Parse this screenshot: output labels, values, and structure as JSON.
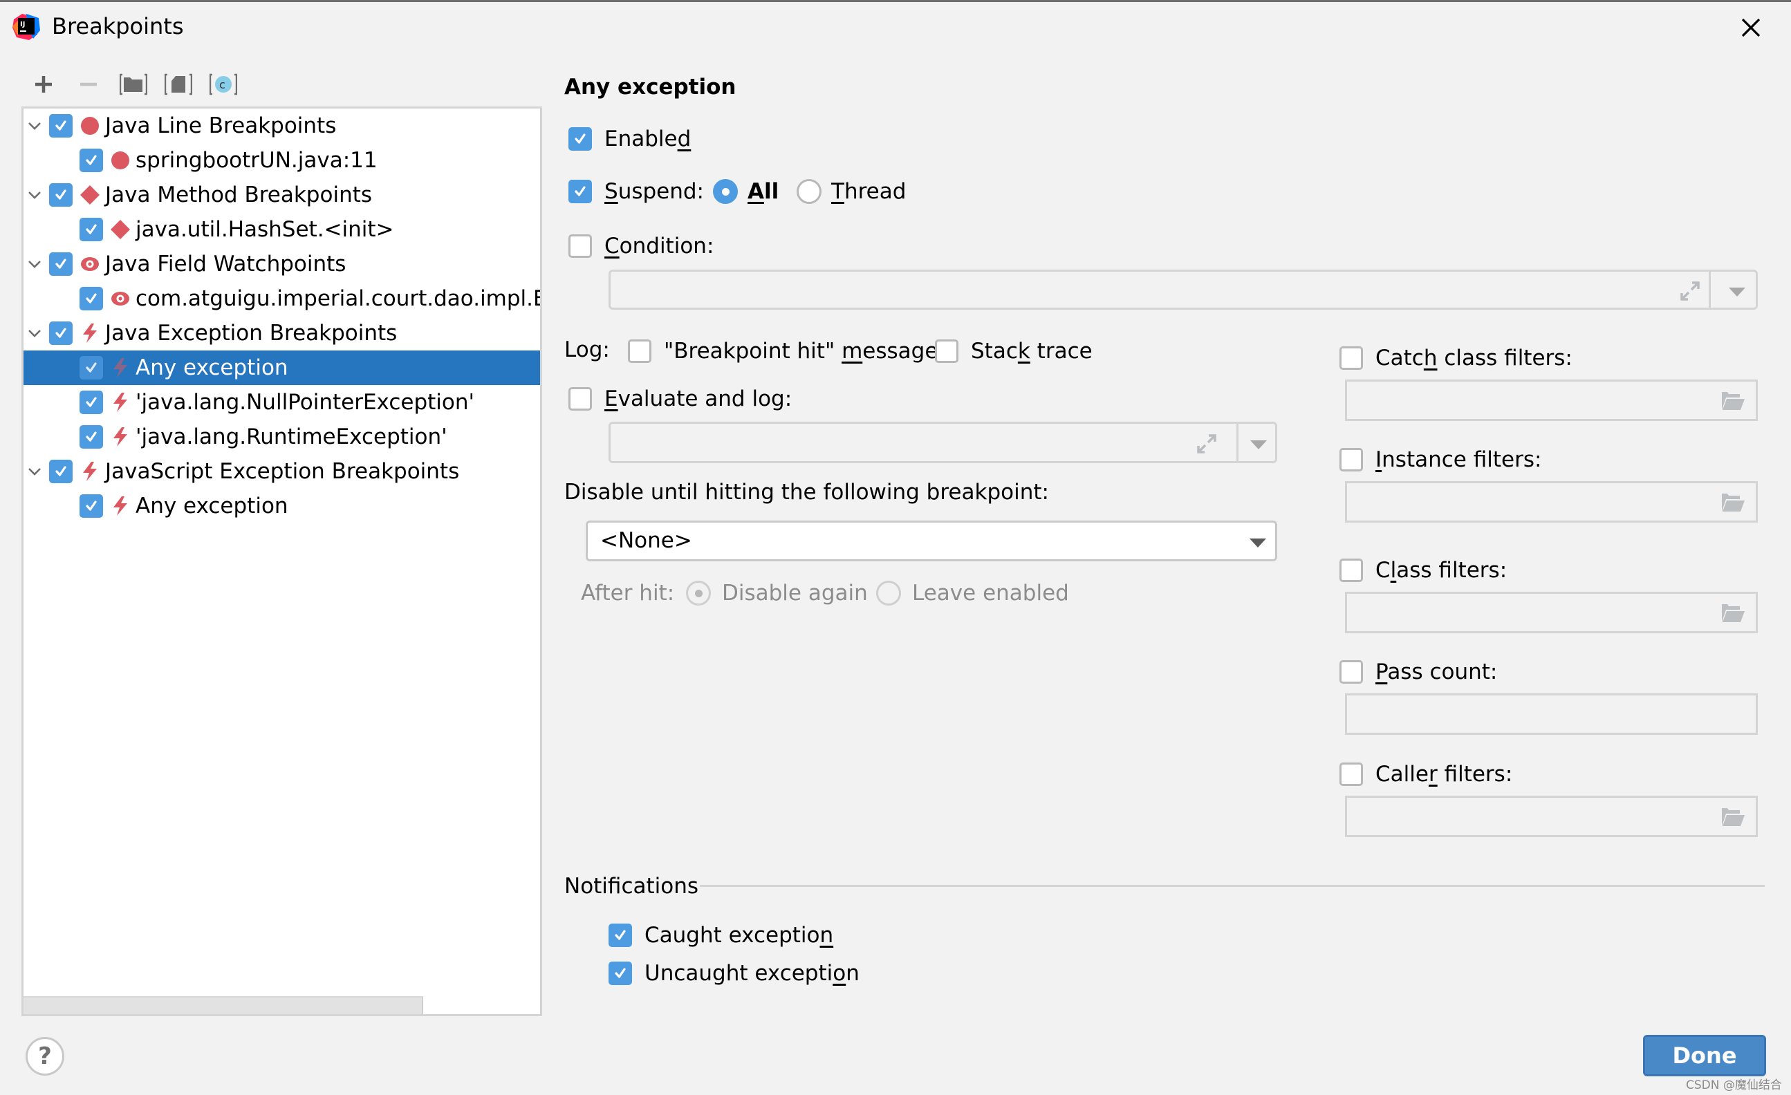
{
  "window": {
    "title": "Breakpoints",
    "app_icon": "intellij-idea-icon",
    "close_icon": "close-icon"
  },
  "toolbar": {
    "buttons": [
      {
        "name": "add-breakpoint-button",
        "icon": "plus-icon",
        "enabled": true
      },
      {
        "name": "remove-breakpoint-button",
        "icon": "minus-icon",
        "enabled": false
      },
      {
        "name": "group-by-package-button",
        "icon": "folder-group-icon",
        "enabled": true
      },
      {
        "name": "group-by-file-button",
        "icon": "file-group-icon",
        "enabled": true
      },
      {
        "name": "group-by-class-button",
        "icon": "class-group-icon",
        "enabled": true
      }
    ]
  },
  "tree": {
    "items": [
      {
        "label": "Java Line Breakpoints",
        "level": 0,
        "expanded": true,
        "checked": true,
        "icon": "line-breakpoint-icon"
      },
      {
        "label": "springbootrUN.java:11",
        "level": 1,
        "checked": true,
        "icon": "line-breakpoint-icon"
      },
      {
        "label": "Java Method Breakpoints",
        "level": 0,
        "expanded": true,
        "checked": true,
        "icon": "method-breakpoint-icon"
      },
      {
        "label": "java.util.HashSet.<init>",
        "level": 1,
        "checked": true,
        "icon": "method-breakpoint-icon"
      },
      {
        "label": "Java Field Watchpoints",
        "level": 0,
        "expanded": true,
        "checked": true,
        "icon": "field-watchpoint-icon"
      },
      {
        "label": "com.atguigu.imperial.court.dao.impl.Em",
        "level": 1,
        "checked": true,
        "icon": "field-watchpoint-icon"
      },
      {
        "label": "Java Exception Breakpoints",
        "level": 0,
        "expanded": true,
        "checked": true,
        "icon": "exception-breakpoint-icon"
      },
      {
        "label": "Any exception",
        "level": 1,
        "checked": true,
        "icon": "exception-breakpoint-icon",
        "selected": true
      },
      {
        "label": "'java.lang.NullPointerException'",
        "level": 1,
        "checked": true,
        "icon": "exception-breakpoint-icon"
      },
      {
        "label": "'java.lang.RuntimeException'",
        "level": 1,
        "checked": true,
        "icon": "exception-breakpoint-icon"
      },
      {
        "label": "JavaScript Exception Breakpoints",
        "level": 0,
        "expanded": true,
        "checked": true,
        "icon": "exception-breakpoint-icon"
      },
      {
        "label": "Any exception",
        "level": 1,
        "checked": true,
        "icon": "exception-breakpoint-icon"
      }
    ]
  },
  "details": {
    "heading": "Any exception",
    "enabled": {
      "label_pre": "Enable",
      "label_u": "d",
      "label_post": "",
      "checked": true
    },
    "suspend": {
      "label_u": "S",
      "label_post": "uspend:",
      "checked": true,
      "options": [
        {
          "u": "A",
          "rest": "ll",
          "selected": true
        },
        {
          "u": "T",
          "rest": "hread",
          "selected": false
        }
      ]
    },
    "condition": {
      "label_u": "C",
      "label_post": "ondition:",
      "checked": false,
      "value": ""
    },
    "log": {
      "label": "Log:",
      "breakpoint_hit": {
        "pre": "\"Breakpoint hit\" ",
        "u": "m",
        "post": "essage",
        "checked": false
      },
      "stack_trace": {
        "pre": "Stac",
        "u": "k",
        "post": " trace",
        "checked": false
      }
    },
    "evaluate_and_log": {
      "label_u": "E",
      "label_post": "valuate and log:",
      "checked": false,
      "value": ""
    },
    "disable_until": {
      "label": "Disable until hitting the following breakpoint:",
      "selected": "<None>"
    },
    "after_hit": {
      "label": "After hit:",
      "options": [
        {
          "label": "Disable again",
          "selected": true
        },
        {
          "label": "Leave enabled",
          "selected": false
        }
      ]
    },
    "filters": [
      {
        "pre": "Catc",
        "u": "h",
        "post": " class filters:",
        "checked": false,
        "value": "",
        "has_browse": true
      },
      {
        "pre": "",
        "u": "I",
        "post": "nstance filters:",
        "checked": false,
        "value": "",
        "has_browse": true
      },
      {
        "pre": "C",
        "u": "l",
        "post": "ass filters:",
        "checked": false,
        "value": "",
        "has_browse": true
      },
      {
        "pre": "",
        "u": "P",
        "post": "ass count:",
        "checked": false,
        "value": "",
        "has_browse": false
      },
      {
        "pre": "Calle",
        "u": "r",
        "post": " filters:",
        "checked": false,
        "value": "",
        "has_browse": true
      }
    ],
    "notifications": {
      "title": "Notifications",
      "caught": {
        "pre": "Caught exceptio",
        "u": "n",
        "post": "",
        "checked": true
      },
      "uncaught": {
        "pre": "Uncaught excepti",
        "u": "o",
        "post": "n",
        "checked": true
      }
    }
  },
  "footer": {
    "help_label": "?",
    "done_label": "Done",
    "watermark": "CSDN @魔仙结合"
  },
  "colors": {
    "accent": "#4d9be0",
    "selection": "#2675bf",
    "breakpoint_red": "#db5860",
    "done_button": "#4a89c8"
  }
}
